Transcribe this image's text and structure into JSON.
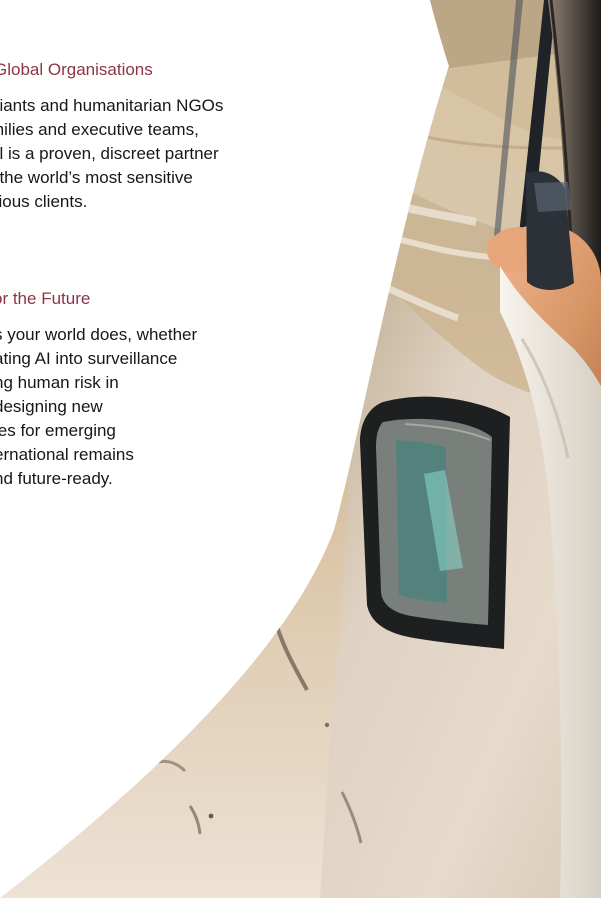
{
  "section_one": {
    "heading": "Global Organisations",
    "body_lines": [
      "giants and humanitarian NGOs",
      "milies and executive teams,",
      "al is a proven, discreet partner",
      "f the world’s most sensitive",
      "cious clients."
    ]
  },
  "section_two": {
    "heading": "or the Future",
    "body_lines": [
      "s your world does, whether",
      "ating AI into surveillance",
      "ng human risk in",
      "designing new",
      "ies for emerging",
      "ernational remains",
      "nd future-ready."
    ]
  },
  "colors": {
    "heading_accent": "#8f3446",
    "body_text": "#171717",
    "page_background": "#ffffff"
  }
}
